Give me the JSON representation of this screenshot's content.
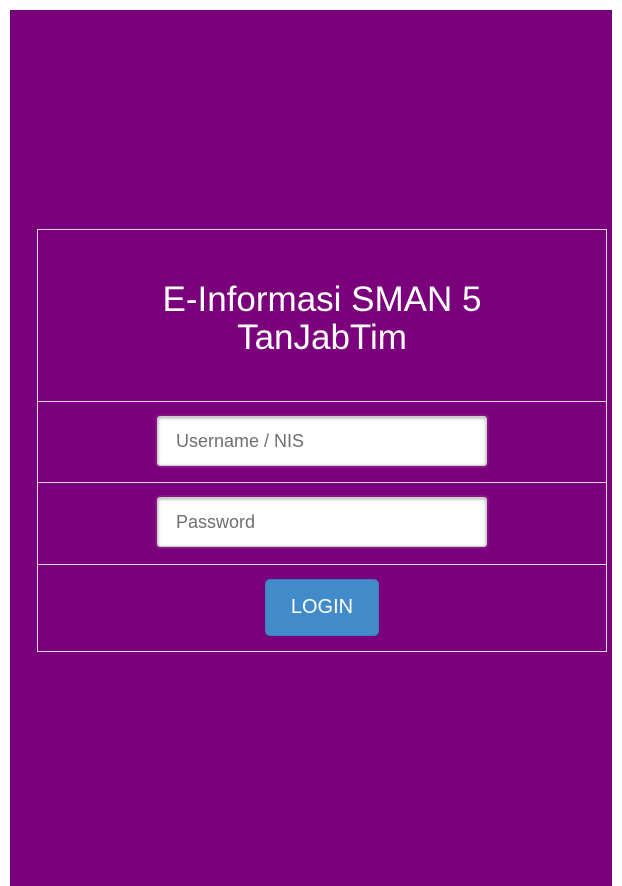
{
  "login": {
    "title_line1": "E-Informasi SMAN 5",
    "title_line2": "TanJabTim",
    "username_placeholder": "Username / NIS",
    "username_value": "",
    "password_placeholder": "Password",
    "password_value": "",
    "login_label": "LOGIN"
  },
  "colors": {
    "background": "#7b007b",
    "button": "#428bca",
    "text": "#ffffff"
  }
}
